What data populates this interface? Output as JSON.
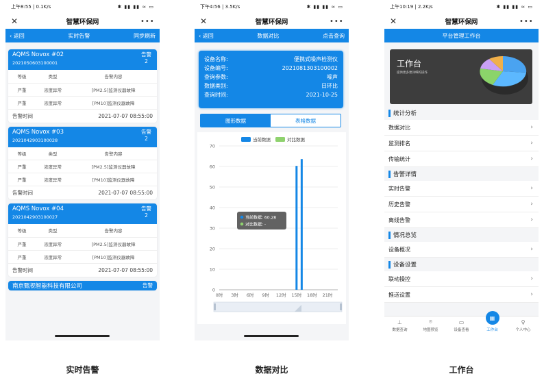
{
  "captions": [
    "实时告警",
    "数据对比",
    "工作台"
  ],
  "screens": [
    {
      "status": {
        "time": "上午8:55 | 0.1K/s",
        "signal": "✱ ▮▮ ▮▮ ≈ ▭"
      },
      "app_title": "智慧环保网",
      "nav": {
        "back": "‹ 返回",
        "title": "实时告警",
        "action": "同步刷新"
      },
      "alarm_label": "告警",
      "table_header": [
        "等级",
        "类型",
        "告警内容"
      ],
      "time_label": "告警时间",
      "cards": [
        {
          "device": "AQMS Novox #02",
          "code": "2021050603100001",
          "count": "2",
          "rows": [
            [
              "严重",
              "浓度异常",
              "[PM2.5]监测仪器故障"
            ],
            [
              "严重",
              "浓度异常",
              "[PM10]监测仪器故障"
            ]
          ],
          "time": "2021-07-07 08:55:00"
        },
        {
          "device": "AQMS Novox #03",
          "code": "2021042903100028",
          "count": "2",
          "rows": [
            [
              "严重",
              "浓度异常",
              "[PM2.5]监测仪器故障"
            ],
            [
              "严重",
              "浓度异常",
              "[PM10]监测仪器故障"
            ]
          ],
          "time": "2021-07-07 08:55:00"
        },
        {
          "device": "AQMS Novox #04",
          "code": "2021042903100027",
          "count": "2",
          "rows": [
            [
              "严重",
              "浓度异常",
              "[PM2.5]监测仪器故障"
            ],
            [
              "严重",
              "浓度异常",
              "[PM10]监测仪器故障"
            ]
          ],
          "time": "2021-07-07 08:55:00"
        }
      ],
      "last_card": {
        "device": "南京甄视智能科技有限公司",
        "badge": "告警"
      }
    },
    {
      "status": {
        "time": "下午4:56 | 3.5K/s",
        "signal": "✱ ▮▮ ▮▮ ≈ ▭"
      },
      "app_title": "智慧环保网",
      "nav": {
        "back": "‹ 返回",
        "title": "数据对比",
        "action": "点击查询"
      },
      "info": [
        {
          "k": "设备名称:",
          "v": "便携式噪声检测仪"
        },
        {
          "k": "设备编号:",
          "v": "2021081303100002"
        },
        {
          "k": "查询参数:",
          "v": "噪声"
        },
        {
          "k": "数据类别:",
          "v": "日环比"
        },
        {
          "k": "查询时间:",
          "v": "2021-10-25"
        }
      ],
      "tabs": [
        "图形数据",
        "表格数据"
      ],
      "tooltip": {
        "current": "当前数据: 60.28",
        "compare": "对比数据: -"
      }
    },
    {
      "status": {
        "time": "上午10:19 | 2.2K/s",
        "signal": "✱ ▮▮ ▮▮ ≈ ▭"
      },
      "app_title": "智慧环保网",
      "nav": {
        "title": "平台管理工作台"
      },
      "banner": {
        "title": "工作台",
        "subtitle": "提供更多更详细的操作"
      },
      "sections": [
        {
          "title": "统计分析",
          "items": [
            "数据对比",
            "监测排名",
            "传输统计"
          ]
        },
        {
          "title": "告警详情",
          "items": [
            "实时告警",
            "历史告警",
            "离线告警"
          ]
        },
        {
          "title": "情况总览",
          "items": [
            "设备概况"
          ]
        },
        {
          "title": "设备设置",
          "items": [
            "联动操控",
            "推送设置"
          ]
        }
      ],
      "tabbar": [
        {
          "label": "数据查询",
          "icon": "chart-icon",
          "glyph": "⊥"
        },
        {
          "label": "地图预览",
          "icon": "map-pin-icon",
          "glyph": "⌾"
        },
        {
          "label": "设备查看",
          "icon": "monitor-icon",
          "glyph": "▭"
        },
        {
          "label": "工作台",
          "icon": "grid-icon",
          "glyph": "▦"
        },
        {
          "label": "个人中心",
          "icon": "person-icon",
          "glyph": "♀"
        }
      ]
    }
  ],
  "colors": {
    "primary": "#1487e6",
    "compare": "#8fd26e"
  },
  "chart_data": {
    "type": "bar",
    "title": "",
    "legend": [
      "当前数据",
      "对比数据"
    ],
    "legend_position": "top",
    "xticks": [
      "0时",
      "3时",
      "6时",
      "9时",
      "12时",
      "15时",
      "18时",
      "21时"
    ],
    "yticks": [
      0,
      10,
      20,
      30,
      40,
      50,
      60,
      70
    ],
    "ylim": [
      0,
      70
    ],
    "xlim": [
      0,
      23
    ],
    "grid": true,
    "series": [
      {
        "name": "当前数据",
        "x": [
          15,
          16
        ],
        "values": [
          60.28,
          63.6
        ]
      },
      {
        "name": "对比数据",
        "x": [],
        "values": []
      }
    ]
  }
}
